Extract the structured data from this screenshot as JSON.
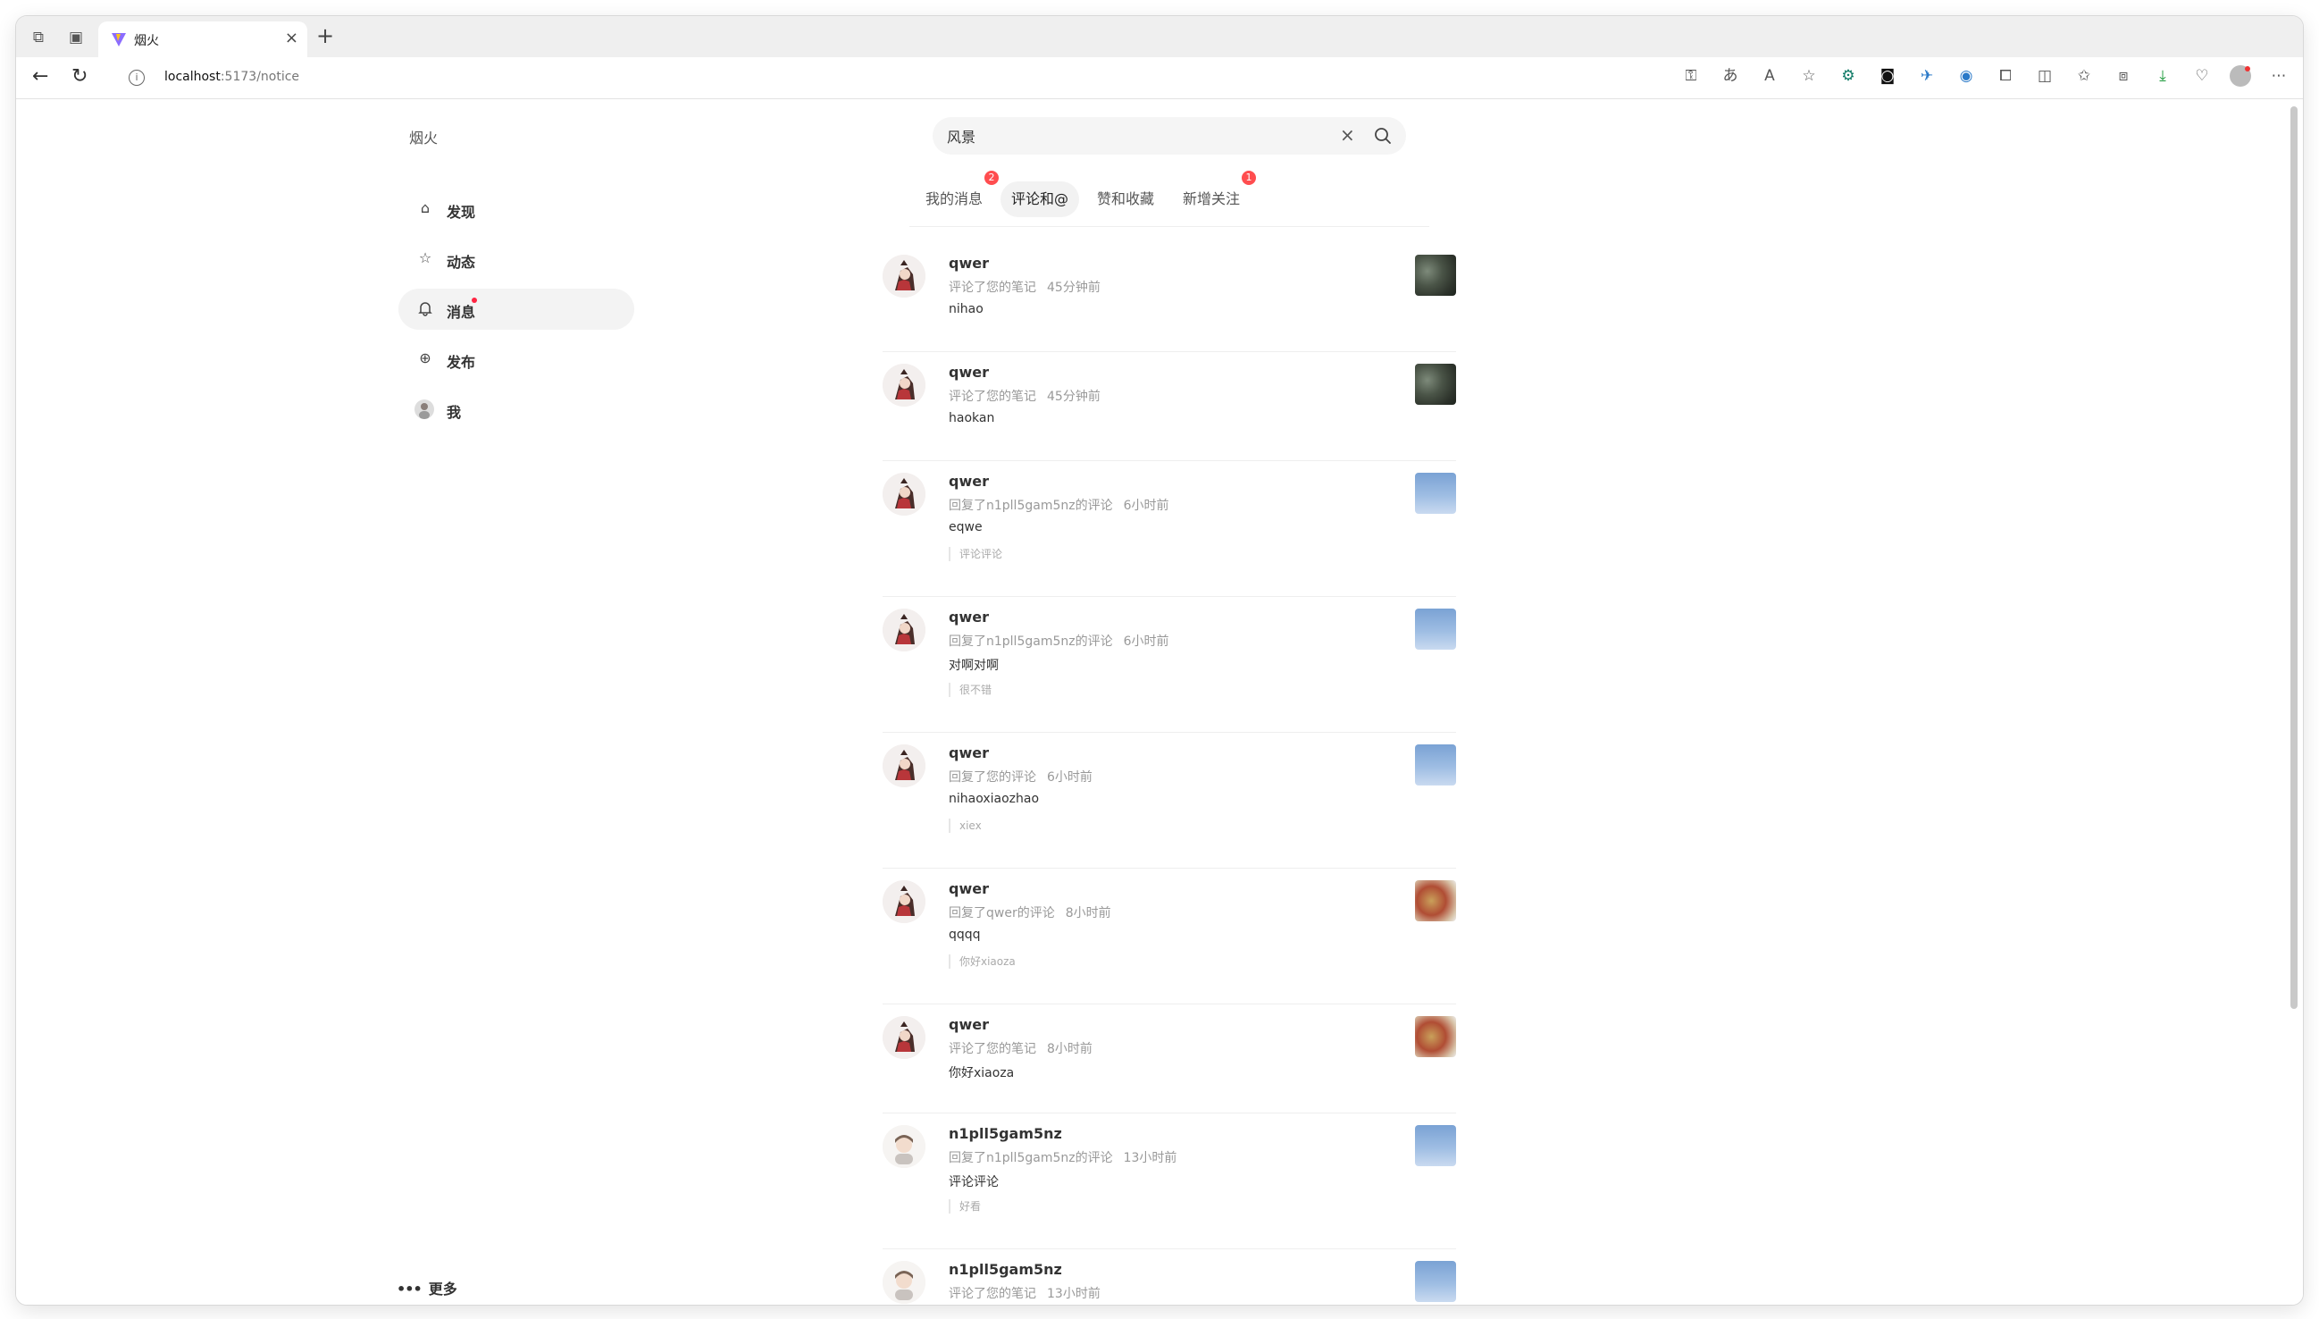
{
  "browser": {
    "tab_title": "烟火",
    "url_host": "localhost",
    "url_path": ":5173/notice"
  },
  "app": {
    "logo": "烟火",
    "nav": [
      {
        "label": "发现",
        "icon": "home-icon"
      },
      {
        "label": "动态",
        "icon": "star-icon"
      },
      {
        "label": "消息",
        "icon": "bell-icon",
        "active": true,
        "dot": true
      },
      {
        "label": "发布",
        "icon": "plus-circle-icon"
      },
      {
        "label": "我",
        "icon": "avatar"
      }
    ],
    "more_label": "更多"
  },
  "search": {
    "value": "风景"
  },
  "tabs": [
    {
      "label": "我的消息",
      "badge": "2"
    },
    {
      "label": "评论和@",
      "active": true
    },
    {
      "label": "赞和收藏"
    },
    {
      "label": "新增关注",
      "badge": "1"
    }
  ],
  "notices": [
    {
      "user": "qwer",
      "action": "评论了您的笔记",
      "time": "45分钟前",
      "content": "nihao",
      "quote": "",
      "thumb": "dark"
    },
    {
      "user": "qwer",
      "action": "评论了您的笔记",
      "time": "45分钟前",
      "content": "haokan",
      "quote": "",
      "thumb": "dark"
    },
    {
      "user": "qwer",
      "action": "回复了n1pll5gam5nz的评论",
      "time": "6小时前",
      "content": "eqwe",
      "quote": "评论评论",
      "thumb": "sky"
    },
    {
      "user": "qwer",
      "action": "回复了n1pll5gam5nz的评论",
      "time": "6小时前",
      "content": "对啊对啊",
      "quote": "很不错",
      "thumb": "sky"
    },
    {
      "user": "qwer",
      "action": "回复了您的评论",
      "time": "6小时前",
      "content": "nihaoxiaozhao",
      "quote": "xiex",
      "thumb": "sky"
    },
    {
      "user": "qwer",
      "action": "回复了qwer的评论",
      "time": "8小时前",
      "content": "qqqq",
      "quote": "你好xiaoza",
      "thumb": "autumn"
    },
    {
      "user": "qwer",
      "action": "评论了您的笔记",
      "time": "8小时前",
      "content": "你好xiaoza",
      "quote": "",
      "thumb": "autumn"
    },
    {
      "user": "n1pll5gam5nz",
      "action": "回复了n1pll5gam5nz的评论",
      "time": "13小时前",
      "content": "评论评论",
      "quote": "好看",
      "thumb": "sky"
    },
    {
      "user": "n1pll5gam5nz",
      "action": "评论了您的笔记",
      "time": "13小时前",
      "content": "",
      "quote": "",
      "thumb": "sky"
    }
  ]
}
